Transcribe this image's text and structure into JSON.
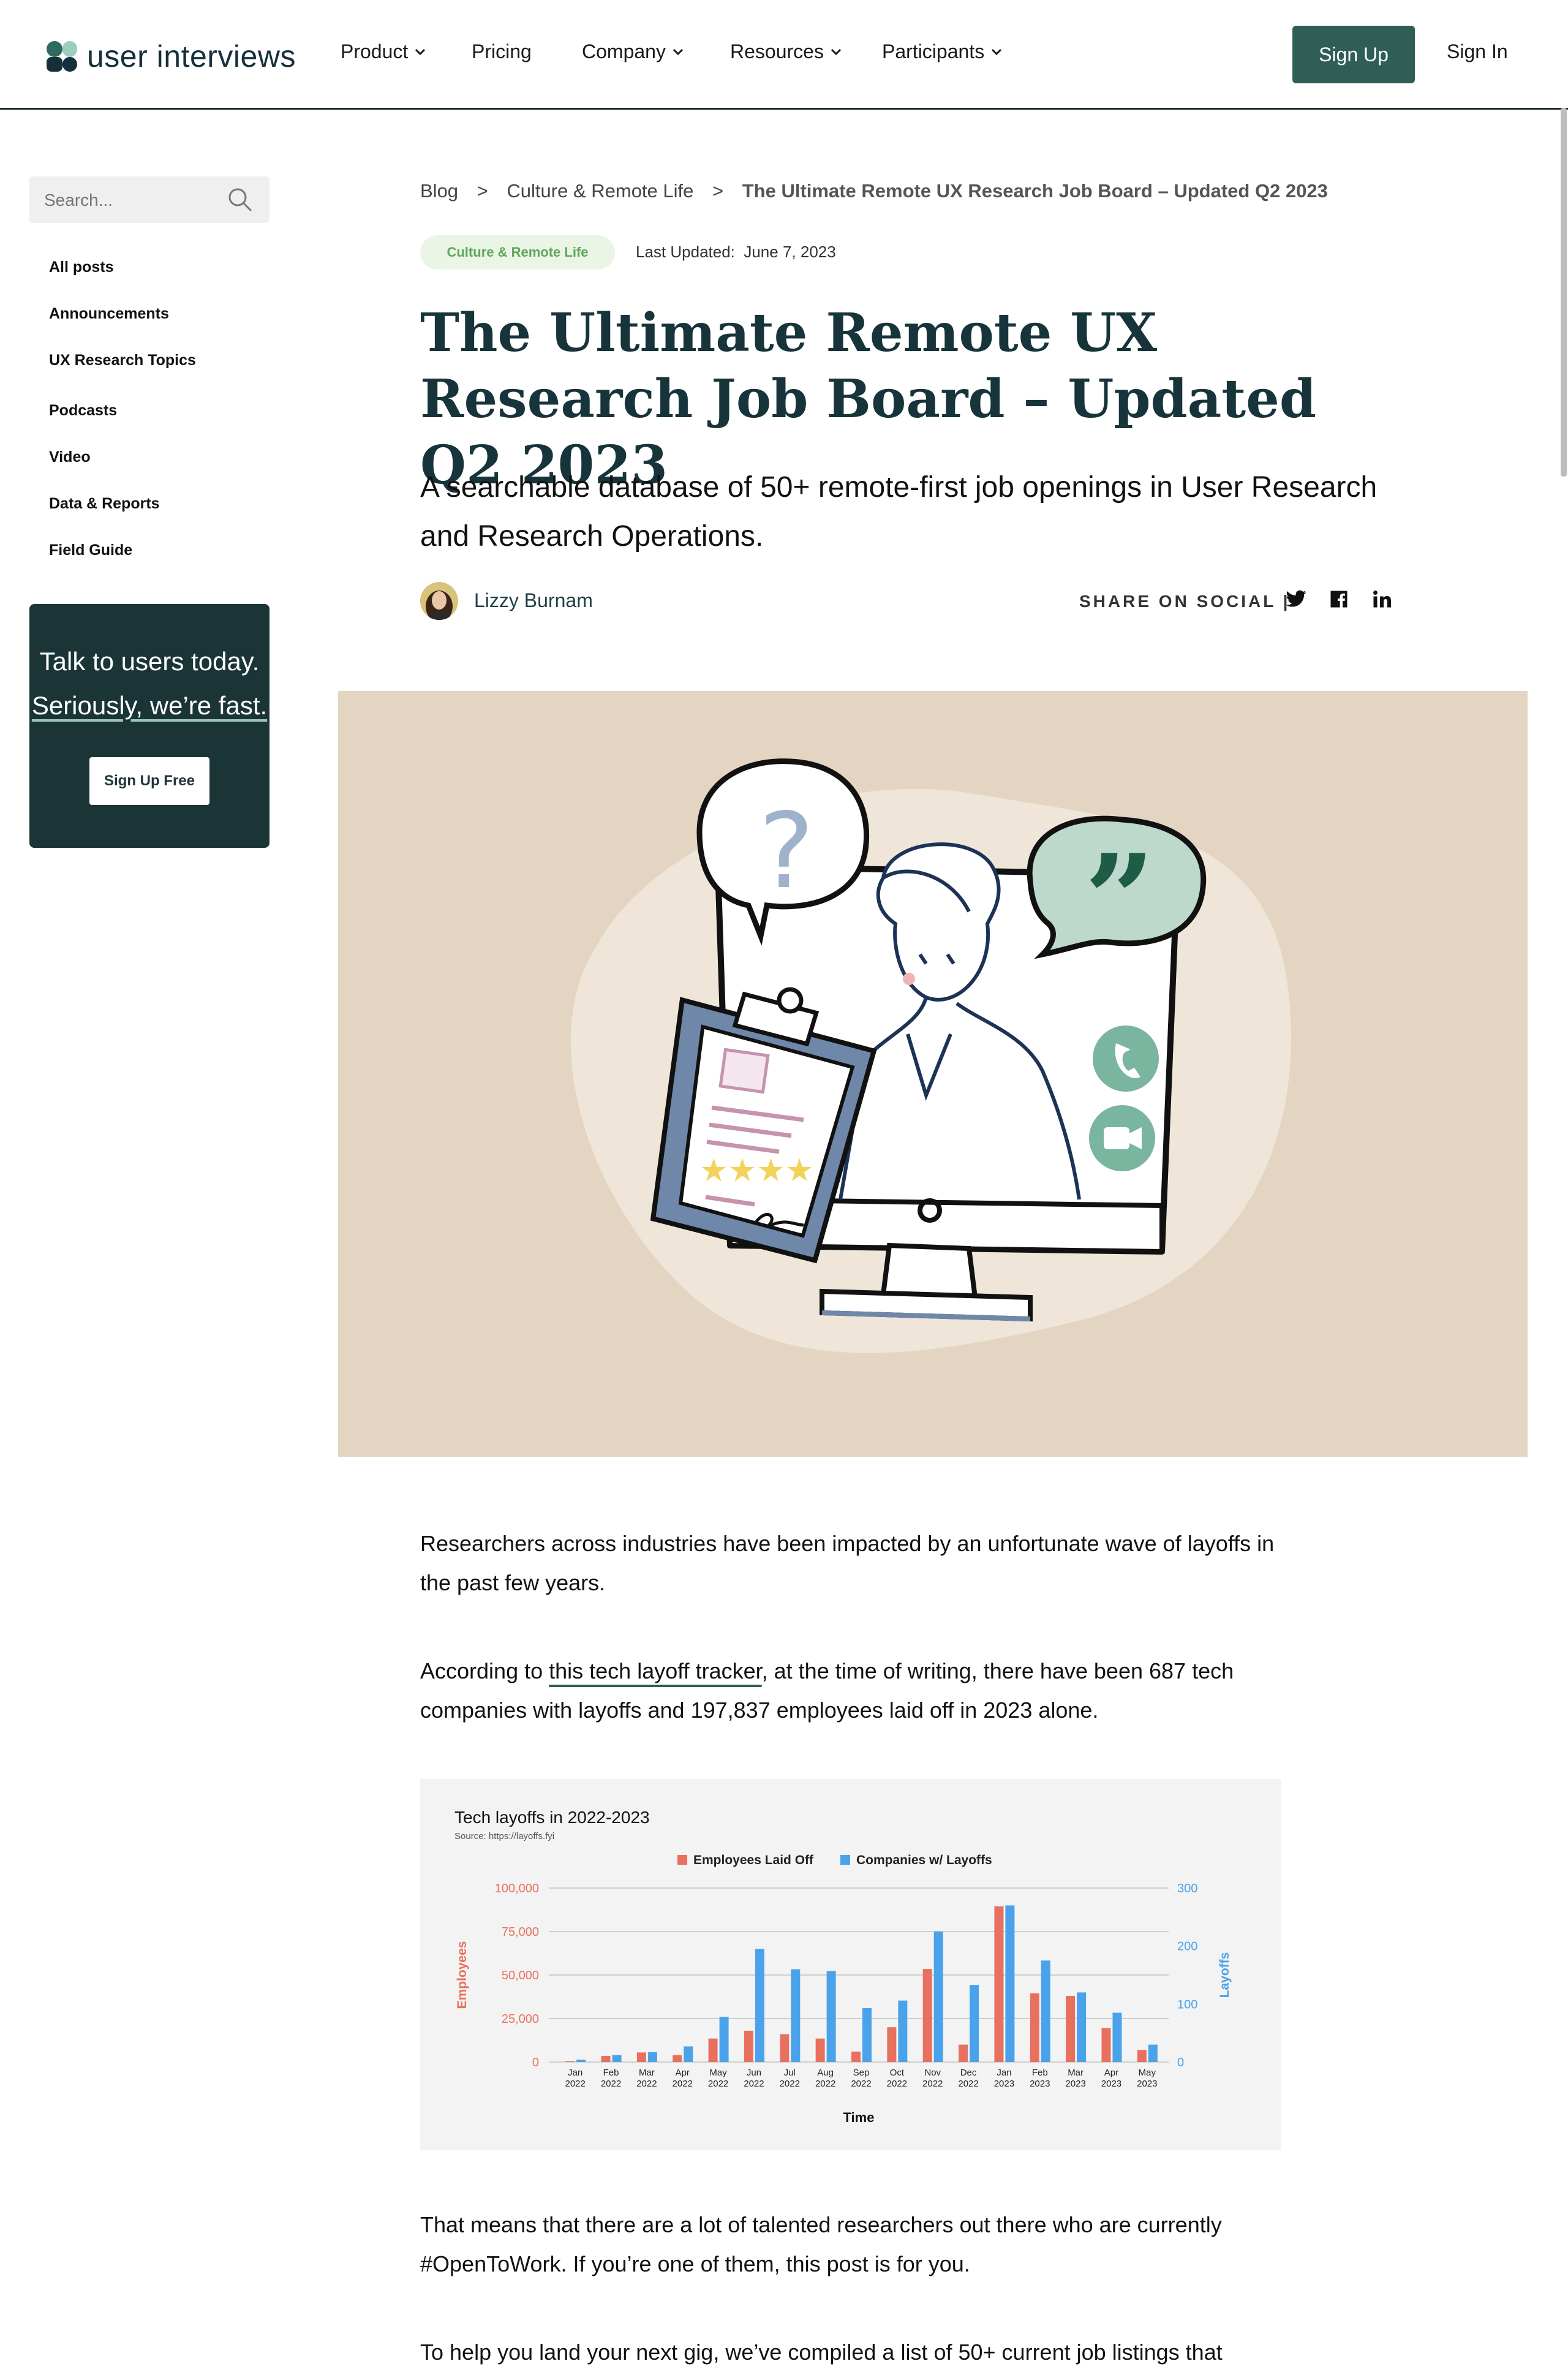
{
  "header": {
    "logo_text": "user interviews",
    "nav": [
      {
        "label": "Product",
        "dropdown": true
      },
      {
        "label": "Pricing",
        "dropdown": false
      },
      {
        "label": "Company",
        "dropdown": true
      },
      {
        "label": "Resources",
        "dropdown": true
      },
      {
        "label": "Participants",
        "dropdown": true
      }
    ],
    "signup_label": "Sign Up",
    "signin_label": "Sign In"
  },
  "sidebar": {
    "search_placeholder": "Search...",
    "items": [
      "All posts",
      "Announcements",
      "UX Research Topics",
      "Podcasts",
      "Video",
      "Data & Reports",
      "Field Guide"
    ],
    "cta": {
      "line1": "Talk to users today.",
      "line2": "Seriously, we’re fast.",
      "button": "Sign Up Free"
    }
  },
  "article": {
    "breadcrumb": [
      "Blog",
      "Culture & Remote Life",
      "The Ultimate Remote UX Research Job Board – Updated Q2 2023"
    ],
    "breadcrumb_sep": ">",
    "tag": "Culture & Remote Life",
    "last_updated_label": "Last Updated:",
    "last_updated_date": "June 7, 2023",
    "title": "The Ultimate Remote UX Research Job Board – Updated Q2 2023",
    "subtitle": "A searchable database of 50+ remote-first job openings in User Research and Research Operations.",
    "author": "Lizzy Burnam",
    "share_label": "SHARE ON SOCIAL |",
    "social_icons": [
      "twitter-icon",
      "facebook-icon",
      "linkedin-icon"
    ],
    "paragraphs": {
      "p1": "Researchers across industries have been impacted by an unfortunate wave of layoffs in the past few years.",
      "p2_before": "According to ",
      "p2_link": "this tech layoff tracker",
      "p2_after": ", at the time of writing, there have been 687 tech companies with layoffs and 197,837 employees laid off in 2023 alone.",
      "p3": "That means that there are a lot of talented researchers out there who are currently #OpenToWork. If you’re one of them, this post is for you.",
      "p4": "To help you land your next gig, we’ve compiled a list of 50+ current job listings that"
    }
  },
  "colors": {
    "brand_dark": "#1b3536",
    "button_green": "#2e5e56",
    "hero_bg": "#e4d5c2",
    "employees_series": "#e8705f",
    "companies_series": "#4aa3ea"
  },
  "chart_data": {
    "type": "bar",
    "title": "Tech layoffs in 2022-2023",
    "subtitle": "Source: https://layoffs.fyi",
    "xlabel": "Time",
    "ylabel": "Employees",
    "y2label": "Layoffs",
    "ylim": [
      0,
      100000
    ],
    "y2lim": [
      0,
      300
    ],
    "yticks": [
      "0",
      "25,000",
      "50,000",
      "75,000",
      "100,000"
    ],
    "y2ticks": [
      "0",
      "100",
      "200",
      "300"
    ],
    "legend_position": "top-center",
    "grid": true,
    "categories": [
      [
        "Jan",
        "2022"
      ],
      [
        "Feb",
        "2022"
      ],
      [
        "Mar",
        "2022"
      ],
      [
        "Apr",
        "2022"
      ],
      [
        "May",
        "2022"
      ],
      [
        "Jun",
        "2022"
      ],
      [
        "Jul",
        "2022"
      ],
      [
        "Aug",
        "2022"
      ],
      [
        "Sep",
        "2022"
      ],
      [
        "Oct",
        "2022"
      ],
      [
        "Nov",
        "2022"
      ],
      [
        "Dec",
        "2022"
      ],
      [
        "Jan",
        "2023"
      ],
      [
        "Feb",
        "2023"
      ],
      [
        "Mar",
        "2023"
      ],
      [
        "Apr",
        "2023"
      ],
      [
        "May",
        "2023"
      ]
    ],
    "series": [
      {
        "name": "Employees Laid Off",
        "axis": "left",
        "values": [
          500,
          3500,
          5500,
          4000,
          13500,
          18000,
          16000,
          13500,
          6000,
          20000,
          53500,
          10000,
          89500,
          39500,
          38000,
          19500,
          7000
        ]
      },
      {
        "name": "Companies w/ Layoffs",
        "axis": "right",
        "values": [
          4,
          12,
          17,
          27,
          78,
          195,
          160,
          157,
          93,
          106,
          225,
          133,
          270,
          175,
          120,
          85,
          30
        ]
      }
    ]
  }
}
